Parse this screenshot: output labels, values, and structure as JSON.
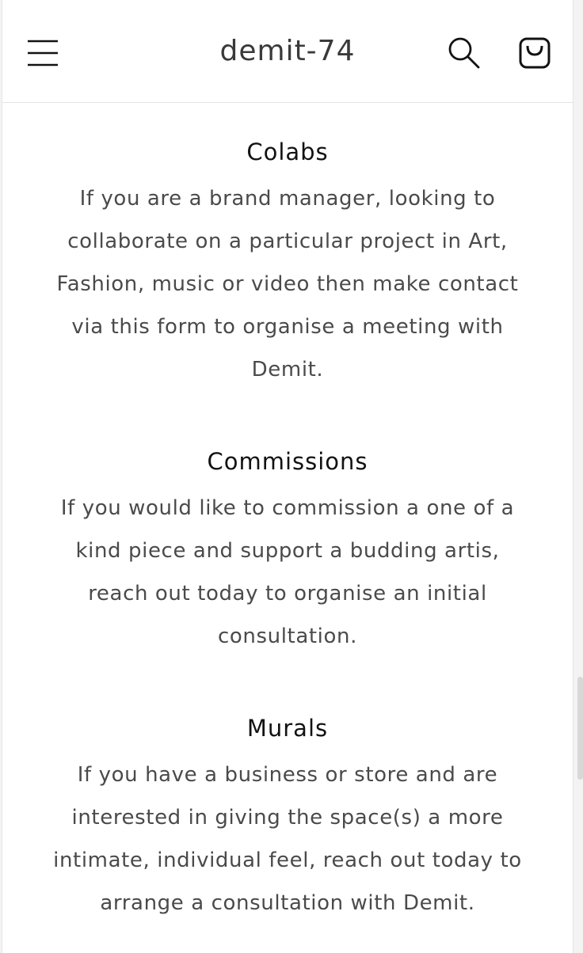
{
  "header": {
    "brand": "demit-74",
    "menu_icon": "hamburger-menu-icon",
    "search_icon": "search-icon",
    "cart_icon": "cart-bag-icon"
  },
  "sections": [
    {
      "title": "Colabs",
      "text": "If you are a brand manager, looking to collaborate on a particular project in Art, Fashion, music or video then make contact via this form to organise a meeting with Demit."
    },
    {
      "title": "Commissions",
      "text": "If you would like to commission a one of a kind piece and support a budding artis, reach out today to organise an initial consultation."
    },
    {
      "title": "Murals",
      "text": "If you have a business or store and are interested in giving the space(s) a more intimate, individual feel, reach out today to arrange a consultation with Demit."
    }
  ],
  "colors": {
    "background": "#ffffff",
    "text": "#4a4a4a",
    "heading": "#121212",
    "border": "#e3e3e3"
  }
}
